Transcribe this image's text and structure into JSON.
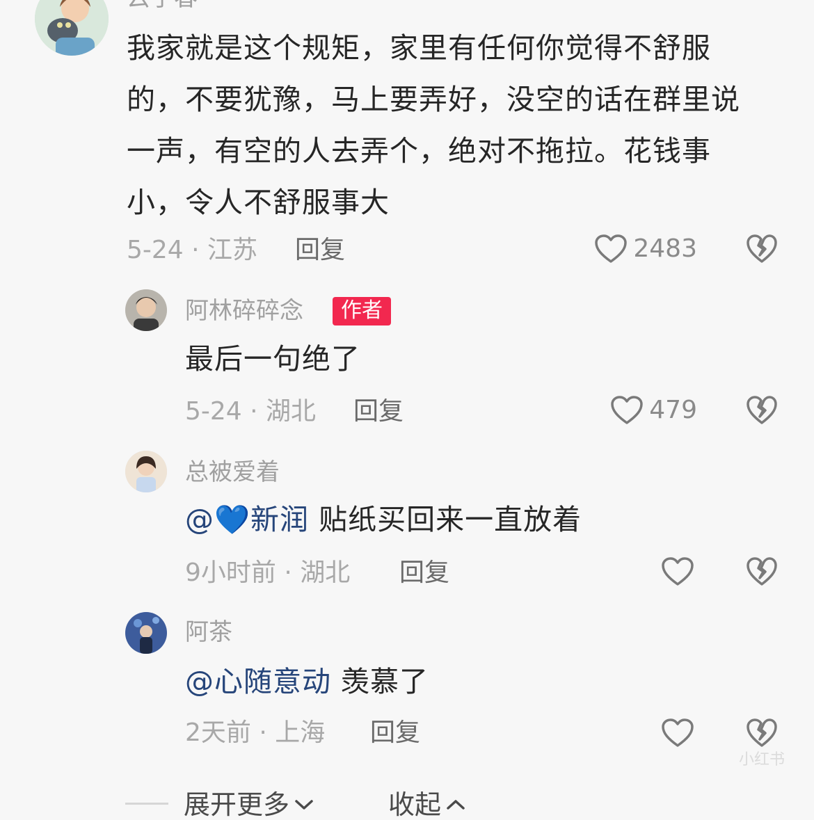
{
  "top_comment": {
    "username": "云子春",
    "text": "我家就是这个规矩，家里有任何你觉得不舒服的，不要犹豫，马上要弄好，没空的话在群里说一声，有空的人去弄个，绝对不拖拉。花钱事小，令人不舒服事大",
    "date_location": "5-24 · 江苏",
    "reply_label": "回复",
    "likes": "2483"
  },
  "replies": [
    {
      "username": "阿林碎碎念",
      "badge": "作者",
      "text": "最后一句绝了",
      "date_location": "5-24 · 湖北",
      "reply_label": "回复",
      "likes": "479"
    },
    {
      "username": "总被爱着",
      "mention": "@💙新润",
      "text": " 贴纸买回来一直放着",
      "date_location": "9小时前 · 湖北",
      "reply_label": "回复",
      "likes": ""
    },
    {
      "username": "阿茶",
      "mention": "@心随意动",
      "text": " 羡慕了",
      "date_location": "2天前 · 上海",
      "reply_label": "回复",
      "likes": ""
    }
  ],
  "footer": {
    "expand_label": "展开更多",
    "collapse_label": "收起"
  },
  "watermark": "小红书",
  "icons": {
    "like": "heart-outline-icon",
    "dislike": "broken-heart-icon",
    "expand": "chevron-down-icon",
    "collapse": "chevron-up-icon"
  },
  "colors": {
    "badge": "#f2284f",
    "mention": "#26457a",
    "meta": "#a8a8a8"
  }
}
